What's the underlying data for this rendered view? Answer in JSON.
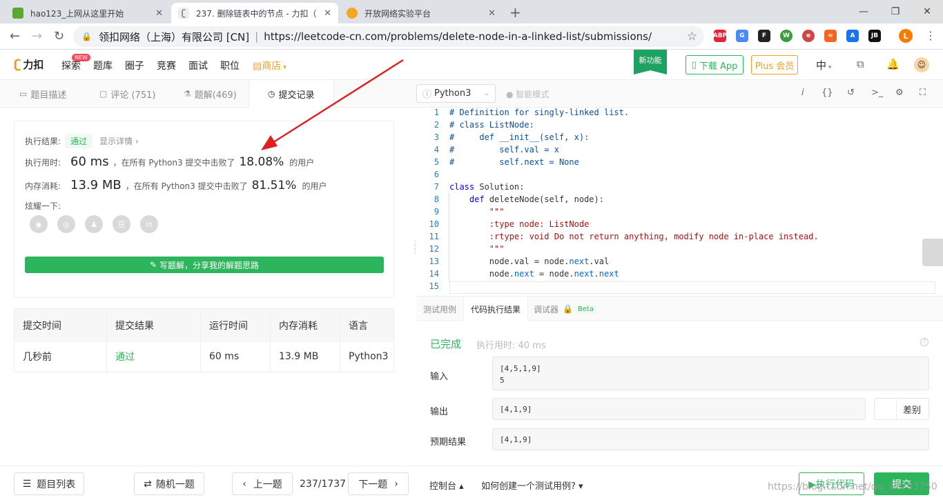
{
  "browser": {
    "tabs": [
      {
        "title": "hao123_上网从这里开始"
      },
      {
        "title": "237. 删除链表中的节点 - 力扣（"
      },
      {
        "title": "开放网络实验平台"
      }
    ],
    "new_tab": "+",
    "site_org": "领扣网络（上海）有限公司 [CN]",
    "url": "https://leetcode-cn.com/problems/delete-node-in-a-linked-list/submissions/",
    "extensions": [
      "ABP",
      "G",
      "F",
      "W",
      "e",
      "∞",
      "A",
      "JB"
    ],
    "profile": "L"
  },
  "nav": {
    "logo": "力扣",
    "links": [
      "探索",
      "题库",
      "圈子",
      "竞赛",
      "面试",
      "职位"
    ],
    "new_badge": "NEW",
    "shop": "商店",
    "feature_badge": "新功能",
    "download": "下载 App",
    "plus": "Plus 会员",
    "lang": "中"
  },
  "left_tabs": [
    {
      "label": "题目描述"
    },
    {
      "label": "评论 (751)"
    },
    {
      "label": "题解(469)"
    },
    {
      "label": "提交记录"
    }
  ],
  "result": {
    "status_label": "执行结果:",
    "status": "通过",
    "details_link": "显示详情 ›",
    "runtime_label": "执行用时:",
    "runtime": "60 ms",
    "runtime_text": "，在所有 Python3 提交中击败了",
    "runtime_pct": "18.08%",
    "users": "的用户",
    "memory_label": "内存消耗:",
    "memory": "13.9 MB",
    "memory_text": "，在所有 Python3 提交中击败了",
    "memory_pct": "81.51%",
    "share_label": "炫耀一下:",
    "share_icons": [
      "wechat",
      "weibo",
      "qq",
      "douban",
      "linkedin"
    ],
    "write_button": "写题解，分享我的解题思路"
  },
  "submissions": {
    "headers": [
      "提交时间",
      "提交结果",
      "运行时间",
      "内存消耗",
      "语言"
    ],
    "rows": [
      [
        "几秒前",
        "通过",
        "60 ms",
        "13.9 MB",
        "Python3"
      ]
    ]
  },
  "editor": {
    "language": "Python3",
    "smart_mode": "智能模式",
    "line_numbers": [
      "1",
      "2",
      "3",
      "4",
      "5",
      "6",
      "7",
      "8",
      "9",
      "10",
      "11",
      "12",
      "13",
      "14",
      "15"
    ]
  },
  "console": {
    "tabs": [
      "测试用例",
      "代码执行结果",
      "调试器"
    ],
    "beta": "Beta",
    "done": "已完成",
    "exec_time": "执行用时: 40 ms",
    "input_label": "输入",
    "input_value_1": "[4,5,1,9]",
    "input_value_2": "5",
    "output_label": "输出",
    "output_value": "[4,1,9]",
    "diff_label": "差别",
    "expected_label": "预期结果",
    "expected_value": "[4,1,9]"
  },
  "footer": {
    "problem_list": "题目列表",
    "random": "随机一题",
    "prev": "上一题",
    "page": "237/1737",
    "next": "下一题",
    "console": "控制台 ▴",
    "how_test": "如何创建一个测试用例? ▾",
    "run": "▶执行代码",
    "submit": "提交",
    "watermark": "https://blog.csdn.net/qq_42793750"
  },
  "colors": {
    "accent": "#2db55d",
    "orange": "#f0a020",
    "arrow": "#e02020"
  }
}
